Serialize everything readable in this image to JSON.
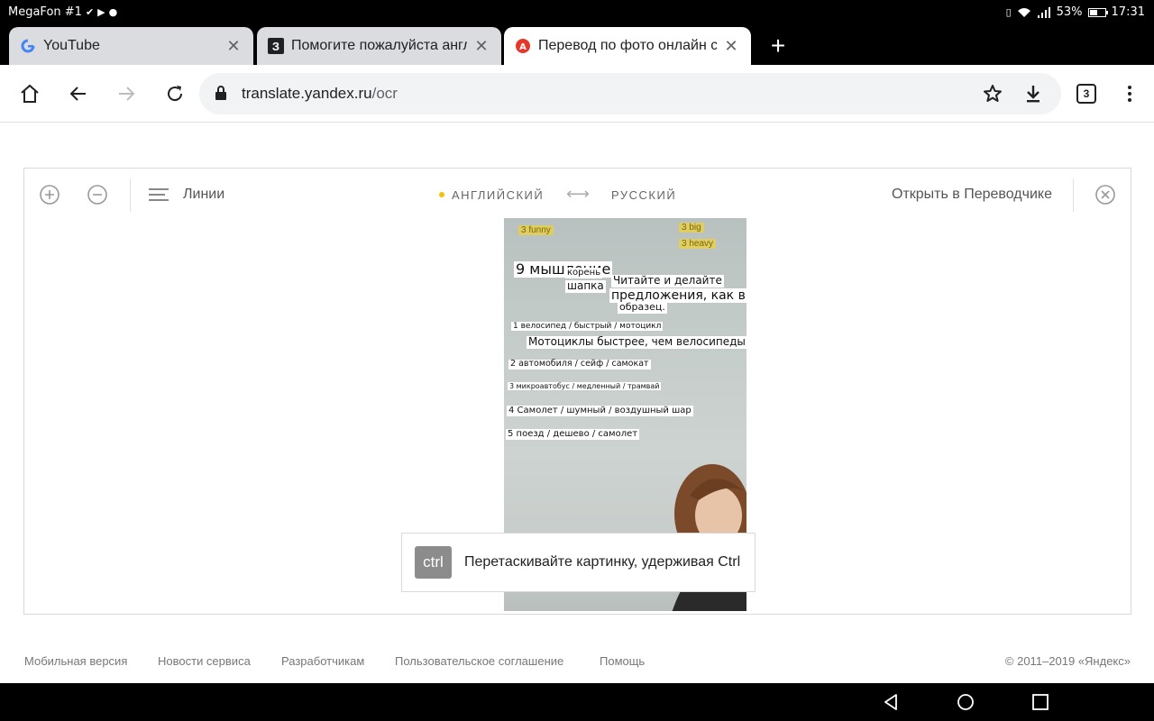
{
  "status_bar": {
    "carrier": "MegaFon #1",
    "battery_text": "53%",
    "battery_level": 0.53,
    "time": "17:31"
  },
  "tabs": [
    {
      "title": "YouTube",
      "favicon": "google-g-icon"
    },
    {
      "title": "Помогите пожалуйста англ",
      "favicon": "znanija-icon"
    },
    {
      "title": "Перевод по фото онлайн с а",
      "favicon": "yandex-translate-icon",
      "active": true
    }
  ],
  "toolbar": {
    "url_host": "translate.yandex.ru",
    "url_path": "/ocr",
    "tab_count": "3"
  },
  "panel": {
    "lines_label": "Линии",
    "source_lang": "АНГЛИЙСКИЙ",
    "target_lang": "РУССКИЙ",
    "open_in_translator": "Открыть в Переводчике",
    "swap_glyph": "⟷"
  },
  "photo": {
    "stickers": [
      "3 funny",
      "3 big",
      "3 heavy"
    ],
    "ocr_lines": [
      "9 мышление",
      "корень",
      "шапка",
      "Читайте и делайте",
      "предложения, как в",
      "образец.",
      "1 велосипед / быстрый / мотоцикл",
      "Мотоциклы быстрее, чем велосипеды.",
      "2 автомобиля / сейф / самокат",
      "3 микроавтобус / медленный / трамвай",
      "4 Самолет / шумный / воздушный шар",
      "5 поезд / дешево / самолет"
    ]
  },
  "hint": {
    "key": "ctrl",
    "text": "Перетаскивайте картинку, удерживая Ctrl"
  },
  "footer": {
    "links": [
      "Мобильная версия",
      "Новости сервиса",
      "Разработчикам",
      "Пользовательское соглашение",
      "Помощь"
    ],
    "copyright": "© 2011–2019 «Яндекс»"
  }
}
